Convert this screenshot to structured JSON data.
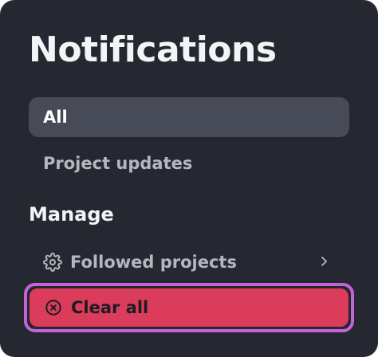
{
  "header": {
    "title": "Notifications"
  },
  "nav": {
    "items": [
      {
        "label": "All",
        "selected": true
      },
      {
        "label": "Project updates",
        "selected": false
      }
    ]
  },
  "manage": {
    "heading": "Manage",
    "followed_label": "Followed projects",
    "followed_icon": "gear-icon",
    "followed_trailing_icon": "chevron-right-icon",
    "clear_label": "Clear all",
    "clear_icon": "x-circle-icon",
    "clear_focused": true
  },
  "colors": {
    "panel_bg": "#252830",
    "selected_bg": "#474b57",
    "danger": "#dc3c5c",
    "focus_ring": "#c463d8",
    "text_primary": "#f3f4f6",
    "text_muted": "#b3b7bf"
  }
}
